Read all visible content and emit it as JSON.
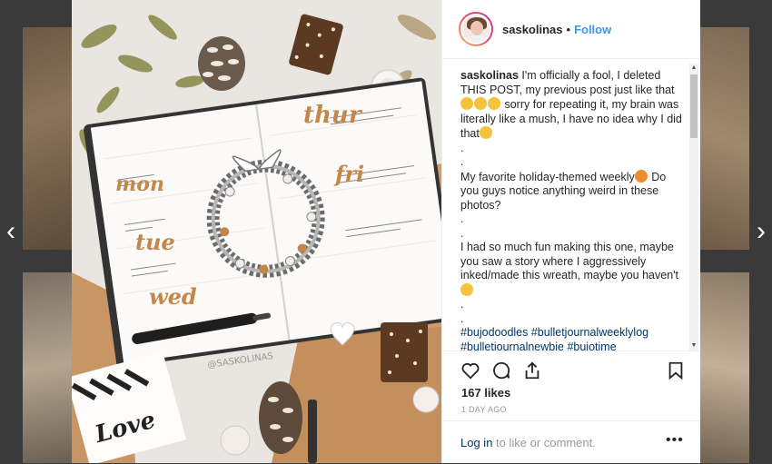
{
  "post": {
    "username": "saskolinas",
    "separator": "•",
    "follow_label": "Follow",
    "caption_lines": [
      "I'm officially a fool, I deleted THIS POST, my previous post just like that",
      "sorry for repeating it, my brain was literally like a mush, I have no idea why I did that",
      ".",
      ".",
      "My favorite holiday-themed weekly",
      "Do you guys notice anything weird in these photos?",
      ".",
      ".",
      "I had so much fun making this one, maybe you saw a story where I aggressively inked/made this wreath, maybe you haven't",
      ".",
      ".",
      "#bujodoodles #bulletjournalweeklylog #bulletjournalnewbie #bujotime"
    ],
    "likes": "167 likes",
    "timestamp": "1 DAY AGO",
    "login_link": "Log in",
    "login_rest": " to like or comment.",
    "more_icon": "•••"
  },
  "photo": {
    "day_labels": [
      "mon",
      "tue",
      "wed",
      "thur",
      "fri"
    ],
    "watermark": "@SASKOLINAS",
    "card_text": "Love"
  },
  "nav": {
    "prev": "‹",
    "next": "›"
  },
  "colors": {
    "link": "#3897f0",
    "hashtag": "#003569",
    "accent": "#c4874a"
  }
}
